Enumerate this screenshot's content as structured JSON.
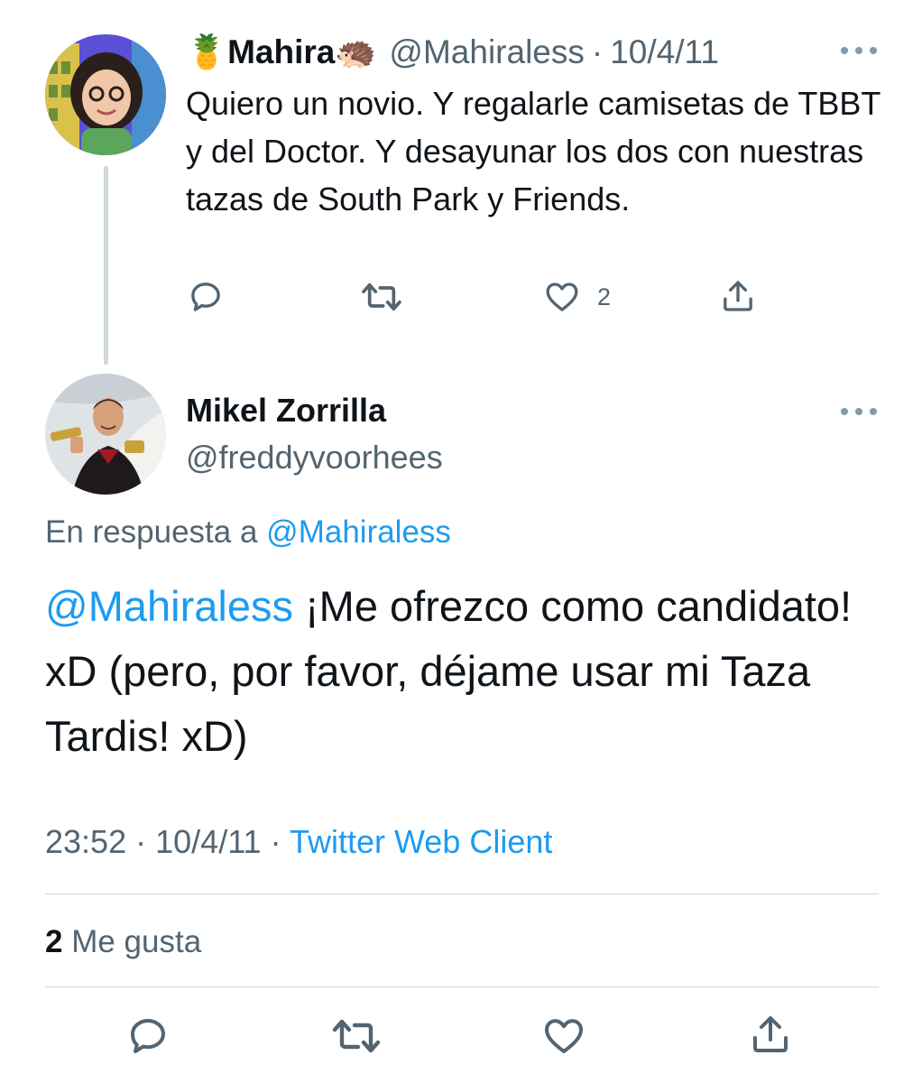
{
  "parent_tweet": {
    "emoji_before_name": "🍍",
    "display_name": "Mahira",
    "emoji_after_name": "🦔",
    "handle": "@Mahiraless",
    "separator": "·",
    "date": "10/4/11",
    "text": "Quiero un novio. Y regalarle camisetas de TBBT y del Doctor. Y desayunar los dos con nuestras tazas de South Park y Friends.",
    "like_count": "2",
    "icons": [
      "reply-icon",
      "retweet-icon",
      "heart-icon",
      "share-icon",
      "more-icon"
    ]
  },
  "main_tweet": {
    "display_name": "Mikel Zorrilla",
    "handle": "@freddyvoorhees",
    "reply_prefix": "En respuesta a",
    "reply_handle": "@Mahiraless",
    "mention": "@Mahiraless",
    "text": "¡Me ofrezco como candidato! xD (pero, por favor, déjame usar mi Taza Tardis! xD)",
    "time": "23:52",
    "separator": "·",
    "date": "10/4/11",
    "source": "Twitter Web Client",
    "likes_count": "2",
    "likes_label": "Me gusta",
    "icons": [
      "reply-icon",
      "retweet-icon",
      "heart-icon",
      "share-icon",
      "more-icon"
    ]
  },
  "colors": {
    "text": "#0f1419",
    "muted": "#536471",
    "link": "#1d9bf0",
    "divider": "#cfd9de"
  }
}
